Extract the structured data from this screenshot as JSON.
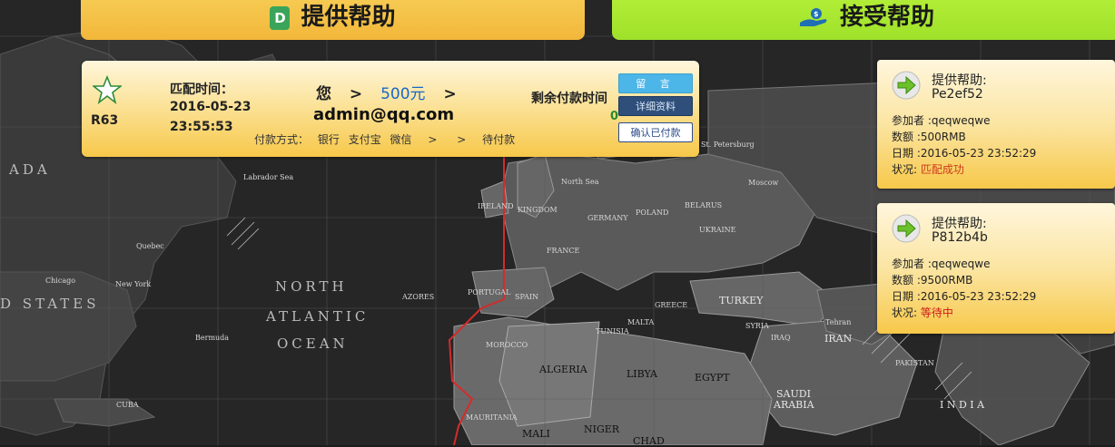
{
  "top_buttons": {
    "provide_label": "提供帮助",
    "receive_label": "接受帮助"
  },
  "match": {
    "id": "R63",
    "match_time_label": "匹配时间：",
    "match_date": "2016-05-23",
    "match_time": "23:55:53",
    "from": "您",
    "arrow": ">",
    "amount": "500元",
    "to_email": "admin@qq.com",
    "payment_label": "付款方式：",
    "payment_methods": [
      "银行",
      "支付宝",
      "微信"
    ],
    "payment_arrows": [
      ">",
      ">"
    ],
    "status": "待付款",
    "remaining_label": "剩余付款时间",
    "remaining_value": "0",
    "buttons": {
      "message": "留 言",
      "details": "详细资料",
      "confirm": "确认已付款"
    }
  },
  "side_panels": [
    {
      "title": "提供帮助:",
      "code": "Pe2ef52",
      "participant": "参加者 :qeqweqwe",
      "amount": "数额 :500RMB",
      "date": "日期 :2016-05-23 23:52:29",
      "status_label": "状况: ",
      "status": "匹配成功"
    },
    {
      "title": "提供帮助:",
      "code": "P812b4b",
      "participant": "参加者 :qeqweqwe",
      "amount": "数额 :9500RMB",
      "date": "日期 :2016-05-23 23:52:29",
      "status_label": "状况: ",
      "status": "等待中"
    }
  ],
  "map_labels": {
    "ada": "ADA",
    "states": "D STATES",
    "north": "NORTH",
    "atlantic": "ATLANTIC",
    "ocean": "OCEAN",
    "algeria": "ALGERIA",
    "libya": "LIBYA",
    "egypt": "EGYPT",
    "saudi": "SAUDI",
    "arabia": "ARABIA",
    "iran": "IRAN",
    "india": "I N D I A",
    "turkey": "TURKEY",
    "mali": "MALI",
    "niger": "NIGER",
    "chad": "CHAD",
    "poland": "POLAND",
    "germany": "GERMANY",
    "france": "FRANCE",
    "spain": "SPAIN",
    "ireland": "IRELAND",
    "morocco": "MOROCCO",
    "tunisia": "TUNISIA",
    "iraq": "IRAQ",
    "ukraine": "UKRAINE",
    "belarus": "BELARUS",
    "moscow": "Moscow",
    "st_petersburg": "St. Petersburg",
    "new_york": "New York",
    "quebec": "Quebec",
    "chicago": "Chicago",
    "pakistan": "PAKISTAN",
    "mauritania": "MAURITANIA",
    "azores": "AZORES",
    "portugal": "PORTUGAL",
    "syria": "SYRIA",
    "malta": "MALTA",
    "greece": "GREECE",
    "tehran": "Tehran",
    "kingdom": "KINGDOM",
    "north_sea": "North Sea",
    "labrador_sea": "Labrador Sea",
    "cuba": "CUBA",
    "bermuda": "Bermuda"
  }
}
